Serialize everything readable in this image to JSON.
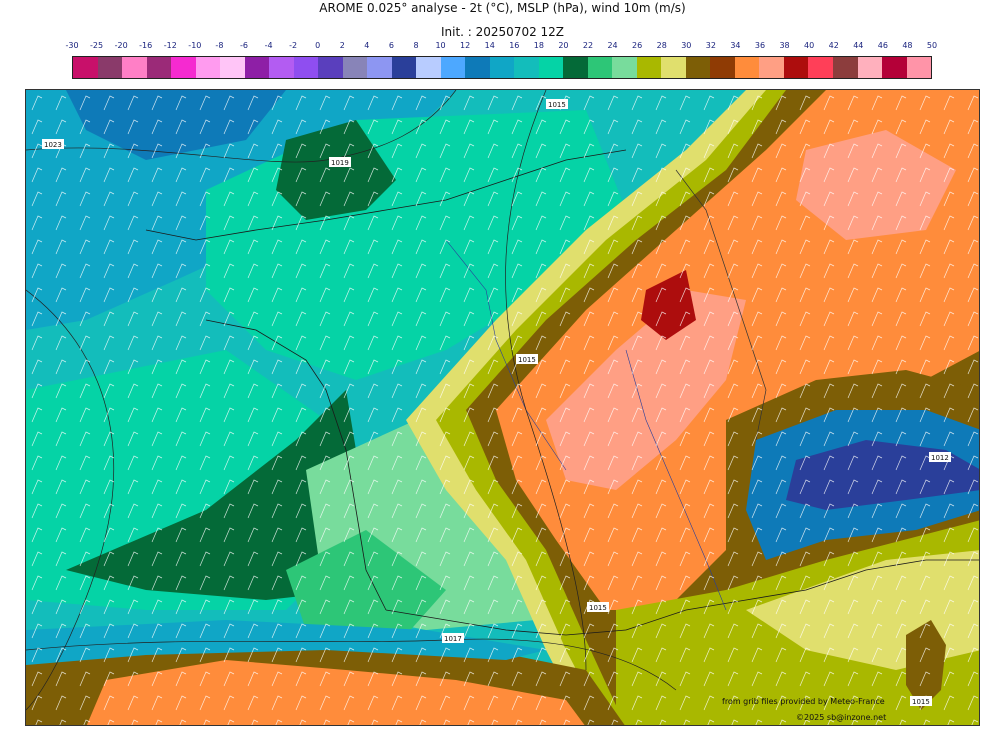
{
  "header": {
    "title": "AROME 0.025° analyse - 2t (°C), MSLP (hPa), wind 10m (m/s)",
    "init": "Init. : 20250702 12Z"
  },
  "legend": {
    "ticks": [
      "-30",
      "-25",
      "-20",
      "-16",
      "-12",
      "-10",
      "-8",
      "-6",
      "-4",
      "-2",
      "0",
      "2",
      "4",
      "6",
      "8",
      "10",
      "12",
      "14",
      "16",
      "18",
      "20",
      "22",
      "24",
      "26",
      "28",
      "30",
      "32",
      "34",
      "36",
      "38",
      "40",
      "42",
      "44",
      "46",
      "48",
      "50"
    ],
    "colors": [
      "#c8106a",
      "#8a3a6a",
      "#ff7fc6",
      "#9b2a78",
      "#f52ad0",
      "#ff9bef",
      "#ffc5f7",
      "#8e1fa6",
      "#b35cf2",
      "#8f4ef0",
      "#5a3fbd",
      "#8884b8",
      "#8d96f2",
      "#2a3f9a",
      "#b8ccff",
      "#4da8ff",
      "#0e7ab8",
      "#10a6c6",
      "#13bdbb",
      "#05d3a6",
      "#046a38",
      "#2dc677",
      "#78dc9c",
      "#a9b800",
      "#e0df6d",
      "#7d5e06",
      "#8f3b04",
      "#ff8c3b",
      "#ff9f84",
      "#ad0d0d",
      "#ff3f58",
      "#8c3d3d",
      "#ffb0bd",
      "#b40038",
      "#ff94a8"
    ]
  },
  "map": {
    "isobar_labels": [
      "1015",
      "1019",
      "1023",
      "1015",
      "1015",
      "1017",
      "1015",
      "1012"
    ]
  },
  "footer": {
    "source": "from grib files provided by Meteo-France",
    "copyright": "©2025 sb@inzone.net"
  }
}
